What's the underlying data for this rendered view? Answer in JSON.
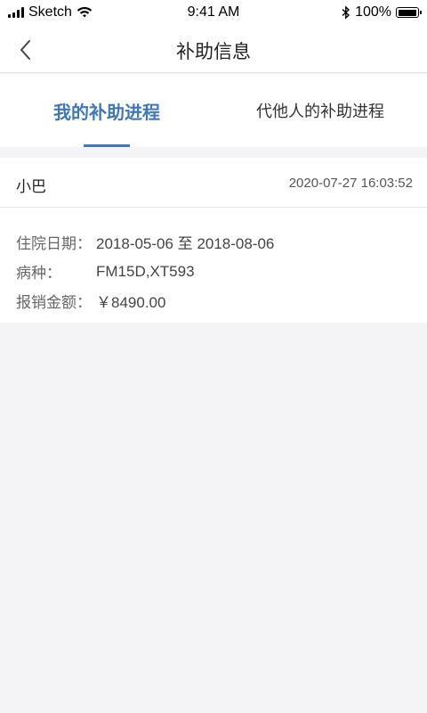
{
  "status_bar": {
    "carrier": "Sketch",
    "time": "9:41 AM",
    "battery": "100%",
    "battery_level": 1.0
  },
  "nav": {
    "title": "补助信息",
    "back_icon": "chevron-left-icon"
  },
  "tabs": [
    {
      "label": "我的补助进程",
      "active": true
    },
    {
      "label": "代他人的补助进程",
      "active": false
    }
  ],
  "record": {
    "name": "小巴",
    "timestamp": "2020-07-27 16:03:52",
    "details": [
      {
        "label": "住院日期：",
        "value": "2018-05-06 至 2018-08-06"
      },
      {
        "label": "病种：",
        "value": "FM15D,XT593"
      },
      {
        "label": "报销金额：",
        "value": "￥8490.00"
      }
    ]
  },
  "colors": {
    "accent": "#3f77bd",
    "background": "#f4f4f6"
  }
}
